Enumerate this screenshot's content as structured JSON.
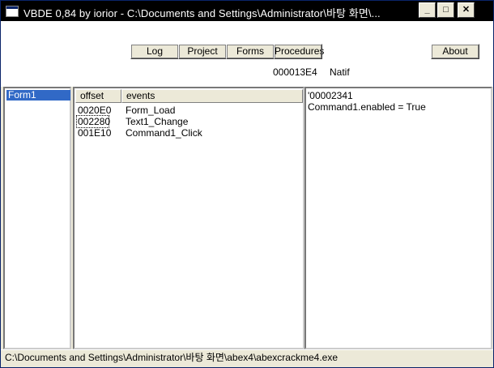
{
  "window": {
    "title": "VBDE 0,84 by iorior - C:\\Documents and Settings\\Administrator\\바탕 화면\\...",
    "min_glyph": "_",
    "max_glyph": "□",
    "close_glyph": "✕"
  },
  "toolbar": {
    "log": "Log",
    "project": "Project",
    "forms": "Forms",
    "procedures": "Procedures",
    "about": "About",
    "offset_value": "000013E4",
    "natif": "Natif"
  },
  "forms_list": [
    "Form1"
  ],
  "events_table": {
    "columns": [
      "offset",
      "events"
    ],
    "rows": [
      {
        "offset": "0020E0",
        "event": "Form_Load"
      },
      {
        "offset": "002280",
        "event": "Text1_Change"
      },
      {
        "offset": "001E10",
        "event": "Command1_Click"
      }
    ]
  },
  "code_view": {
    "lines": [
      "'00002341",
      "Command1.enabled = True"
    ]
  },
  "status": {
    "path": "C:\\Documents and Settings\\Administrator\\바탕 화면\\abex4\\abexcrackme4.exe"
  }
}
